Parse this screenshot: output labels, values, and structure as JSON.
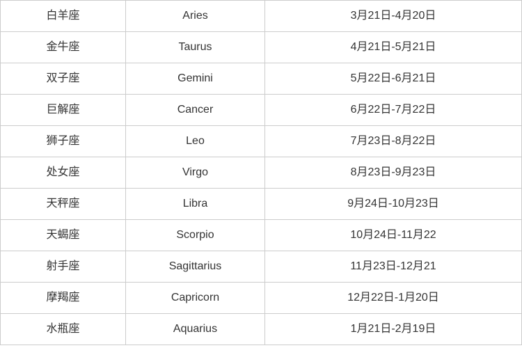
{
  "table": {
    "rows": [
      {
        "chinese": "白羊座",
        "english": "Aries",
        "dates": "3月21日-4月20日"
      },
      {
        "chinese": "金牛座",
        "english": "Taurus",
        "dates": "4月21日-5月21日"
      },
      {
        "chinese": "双子座",
        "english": "Gemini",
        "dates": "5月22日-6月21日"
      },
      {
        "chinese": "巨解座",
        "english": "Cancer",
        "dates": "6月22日-7月22日"
      },
      {
        "chinese": "狮子座",
        "english": "Leo",
        "dates": "7月23日-8月22日"
      },
      {
        "chinese": "处女座",
        "english": "Virgo",
        "dates": "8月23日-9月23日"
      },
      {
        "chinese": "天秤座",
        "english": "Libra",
        "dates": "9月24日-10月23日"
      },
      {
        "chinese": "天蝎座",
        "english": "Scorpio",
        "dates": "10月24日-11月22"
      },
      {
        "chinese": "射手座",
        "english": "Sagittarius",
        "dates": "11月23日-12月21"
      },
      {
        "chinese": "摩羯座",
        "english": "Capricorn",
        "dates": "12月22日-1月20日"
      },
      {
        "chinese": "水瓶座",
        "english": "Aquarius",
        "dates": "1月21日-2月19日"
      }
    ]
  }
}
